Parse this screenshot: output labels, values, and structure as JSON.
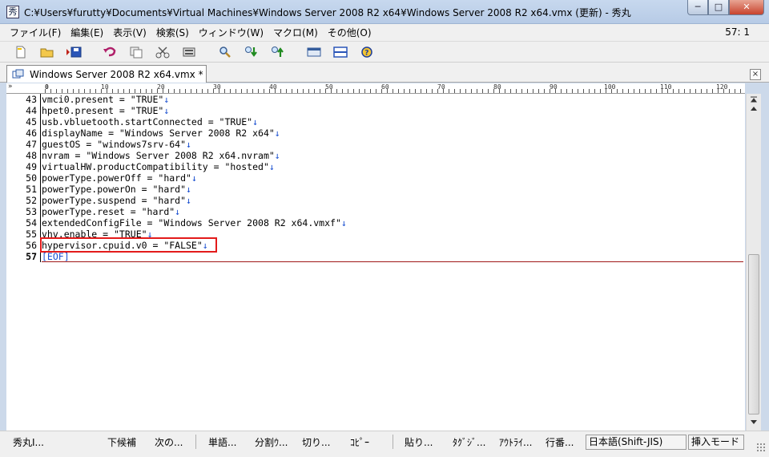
{
  "window": {
    "title": "C:¥Users¥furutty¥Documents¥Virtual Machines¥Windows Server 2008 R2 x64¥Windows Server 2008 R2 x64.vmx (更新) - 秀丸",
    "buttons": {
      "minimize": "─",
      "maximize": "□",
      "close": "✕"
    }
  },
  "menu": {
    "items": [
      "ファイル(F)",
      "編集(E)",
      "表示(V)",
      "検索(S)",
      "ウィンドウ(W)",
      "マクロ(M)",
      "その他(O)"
    ],
    "position": "57: 1"
  },
  "toolbar": {
    "icons": [
      "new-file-icon",
      "open-folder-icon",
      "save-icon",
      "undo-icon",
      "copy-icon",
      "cut-icon",
      "paste-icon",
      "search-icon",
      "search-down-icon",
      "search-up-icon",
      "window-icon",
      "split-window-icon",
      "help-icon"
    ]
  },
  "tab": {
    "label": "Windows Server 2008 R2 x64.vmx *",
    "close": "×"
  },
  "ruler": {
    "prefix": "»",
    "marks": [
      "0",
      "10",
      "20",
      "30",
      "40",
      "50",
      "60",
      "70",
      "80",
      "90",
      "100",
      "110",
      "120"
    ]
  },
  "editor": {
    "newline_glyph": "↓",
    "lines": [
      {
        "num": "43",
        "text": "vmci0.present = \"TRUE\""
      },
      {
        "num": "44",
        "text": "hpet0.present = \"TRUE\""
      },
      {
        "num": "45",
        "text": "usb.vbluetooth.startConnected = \"TRUE\""
      },
      {
        "num": "46",
        "text": "displayName = \"Windows Server 2008 R2 x64\""
      },
      {
        "num": "47",
        "text": "guestOS = \"windows7srv-64\""
      },
      {
        "num": "48",
        "text": "nvram = \"Windows Server 2008 R2 x64.nvram\""
      },
      {
        "num": "49",
        "text": "virtualHW.productCompatibility = \"hosted\""
      },
      {
        "num": "50",
        "text": "powerType.powerOff = \"hard\""
      },
      {
        "num": "51",
        "text": "powerType.powerOn = \"hard\""
      },
      {
        "num": "52",
        "text": "powerType.suspend = \"hard\""
      },
      {
        "num": "53",
        "text": "powerType.reset = \"hard\""
      },
      {
        "num": "54",
        "text": "extendedConfigFile = \"Windows Server 2008 R2 x64.vmxf\""
      },
      {
        "num": "55",
        "text": "vhv.enable = \"TRUE\""
      },
      {
        "num": "56",
        "text": "hypervisor.cpuid.v0 = \"FALSE\""
      }
    ],
    "last_line": {
      "num": "57",
      "text": "[EOF]"
    }
  },
  "statusbar": {
    "function_keys": [
      "秀丸I...",
      "下候補",
      "次の...",
      "単語...",
      "分割ｳ...",
      "切り...",
      "ｺﾋﾟｰ",
      "貼り...",
      "ﾀｸﾞｼﾞ...",
      "ｱｳﾄﾗｲ...",
      "行番..."
    ],
    "encoding": "日本語(Shift-JIS)",
    "mode": "挿入モード"
  }
}
